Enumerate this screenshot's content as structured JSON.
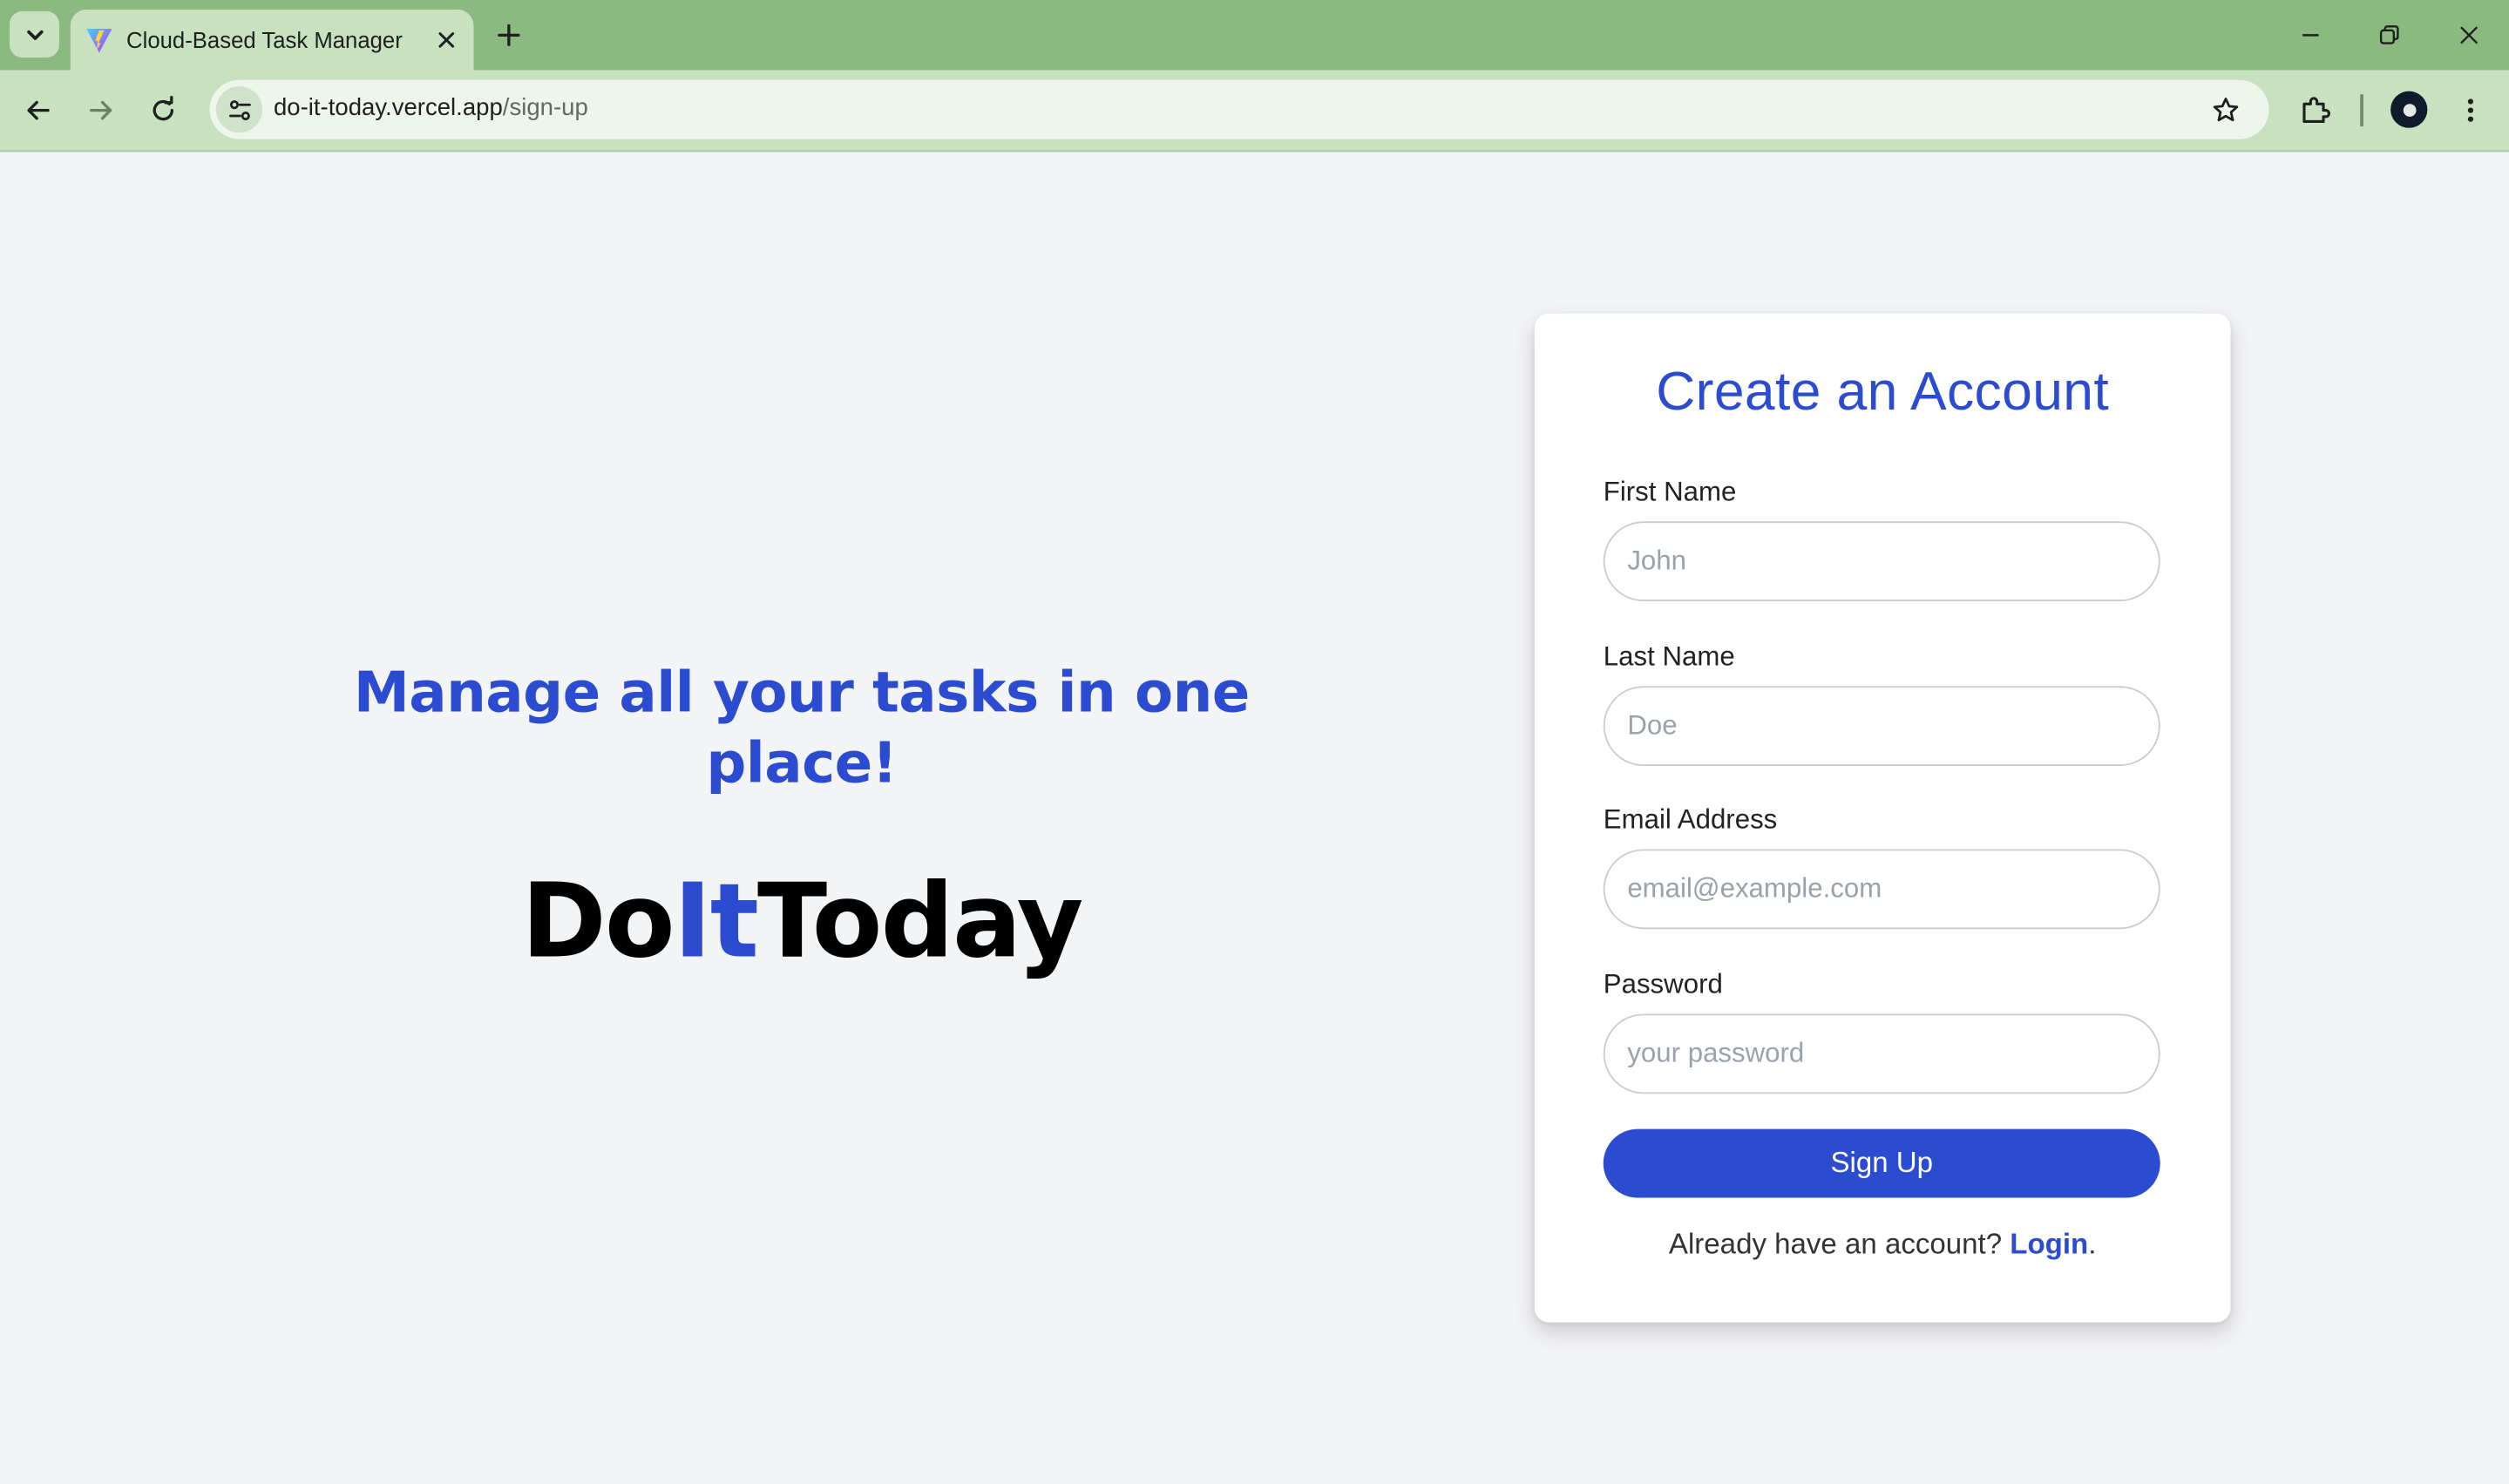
{
  "browser": {
    "tab_title": "Cloud-Based Task Manager",
    "url_host": "do-it-today.vercel.app",
    "url_path": "/sign-up",
    "tab_favicon": "vite-logo-icon"
  },
  "hero": {
    "tagline": "Manage all your tasks in one place!",
    "brand_part1": "Do",
    "brand_part2": "It",
    "brand_part3": "Today"
  },
  "form": {
    "title": "Create an Account",
    "first_name_label": "First Name",
    "first_name_placeholder": "John",
    "last_name_label": "Last Name",
    "last_name_placeholder": "Doe",
    "email_label": "Email Address",
    "email_placeholder": "email@example.com",
    "password_label": "Password",
    "password_placeholder": "your password",
    "submit_label": "Sign Up",
    "login_prompt": "Already have an account? ",
    "login_link": "Login",
    "login_suffix": "."
  },
  "colors": {
    "accent": "#2b4bd1",
    "page_bg": "#f3f4f6",
    "chrome_frame": "#8aba7f",
    "chrome_toolbar": "#c8e2c0"
  }
}
